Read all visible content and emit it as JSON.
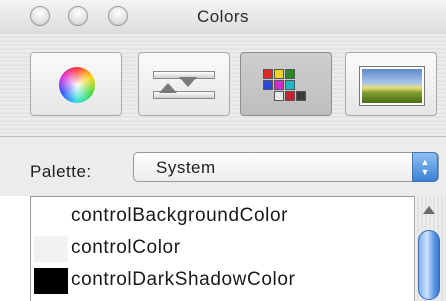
{
  "window": {
    "title": "Colors"
  },
  "toolbar": {
    "modes": [
      {
        "name": "color-wheel",
        "icon": "color-wheel-icon",
        "selected": false
      },
      {
        "name": "color-sliders",
        "icon": "sliders-icon",
        "selected": false
      },
      {
        "name": "color-palettes",
        "icon": "palette-swatches-icon",
        "selected": true
      },
      {
        "name": "image-palettes",
        "icon": "landscape-image-icon",
        "selected": false
      }
    ]
  },
  "palette": {
    "label": "Palette:",
    "selected": "System"
  },
  "colors": {
    "items": [
      {
        "label": "controlBackgroundColor",
        "swatch": "#ffffff"
      },
      {
        "label": "controlColor",
        "swatch": "#f2f2f2"
      },
      {
        "label": "controlDarkShadowColor",
        "swatch": "#000000"
      }
    ]
  },
  "theme": {
    "accent": "#3a80d6"
  }
}
